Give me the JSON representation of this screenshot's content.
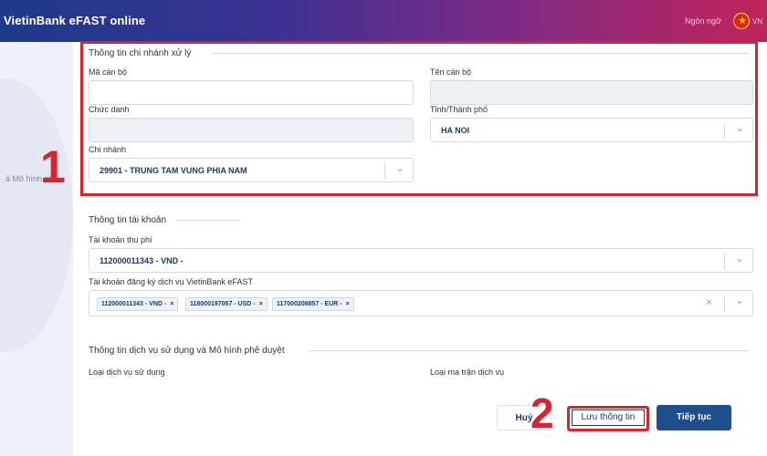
{
  "header": {
    "brand": "VietinBank eFAST online",
    "language_link": "Ngôn ngữ",
    "language_code": "VN"
  },
  "left_panel": {
    "step_text": "à Mô hình phê"
  },
  "branch_section": {
    "title": "Thông tin chi nhánh xử lý",
    "officer_code_label": "Mã cán bộ",
    "officer_code_value": "",
    "officer_name_label": "Tên cán bộ",
    "officer_name_value": "",
    "position_label": "Chức danh",
    "position_value": "",
    "province_label": "Tỉnh/Thành phố",
    "province_value": "HA NOI",
    "branch_label": "Chi nhánh",
    "branch_value": "29901 - TRUNG TAM VUNG PHIA NAM"
  },
  "account_section": {
    "title": "Thông tin tài khoản",
    "fee_account_label": "Tài khoản thu phí",
    "fee_account_value": "112000011343 - VND -",
    "registered_accounts_label": "Tài khoản đăng ký dịch vụ VietinBank eFAST",
    "registered_accounts": [
      "112000011343 - VND -",
      "118000197057 - USD -",
      "117000208857 - EUR -"
    ]
  },
  "service_section": {
    "title": "Thông tin dịch vụ sử dụng và Mô hình phê duyệt",
    "service_type_label": "Loại dịch vụ sử dụng",
    "mix_type_label": "Loại ma trận dịch vụ"
  },
  "annotations": {
    "callout_1": "1",
    "callout_2": "2"
  },
  "actions": {
    "cancel_label": "Huỷ",
    "save_label": "Lưu thông tin",
    "next_label": "Tiếp tục"
  },
  "colors": {
    "highlight_red": "#d9232e",
    "primary_blue": "#1e4e8c",
    "text_blue": "#1b3a6b"
  }
}
